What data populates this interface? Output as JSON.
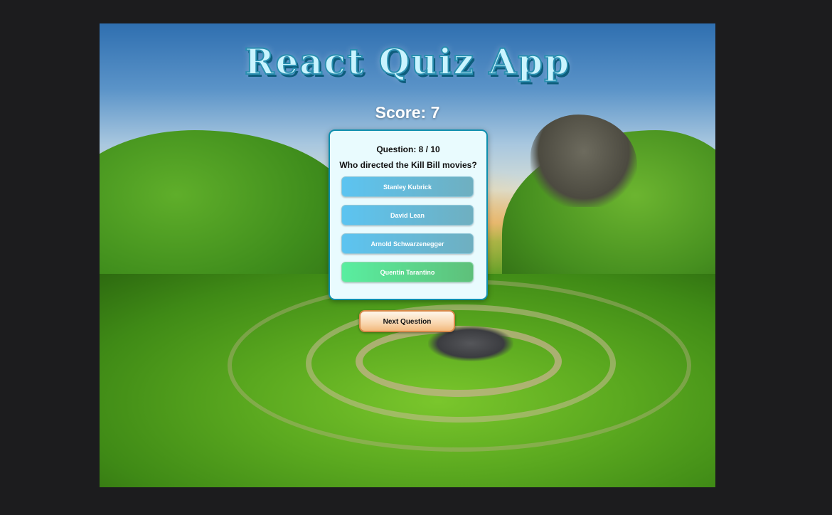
{
  "app": {
    "title": "React Quiz App",
    "score_text": "Score: 7"
  },
  "quiz": {
    "question_number": "Question: 8 / 10",
    "question": "Who directed the Kill Bill movies?",
    "answers": [
      {
        "label": "Stanley Kubrick",
        "state": "default"
      },
      {
        "label": "David Lean",
        "state": "default"
      },
      {
        "label": "Arnold Schwarzenegger",
        "state": "default"
      },
      {
        "label": "Quentin Tarantino",
        "state": "correct"
      }
    ],
    "next_label": "Next Question"
  },
  "colors": {
    "answer_default": "#5cc4f1",
    "answer_correct": "#59eea0",
    "card_border": "#0f8fae",
    "next_border": "#d7894a"
  }
}
